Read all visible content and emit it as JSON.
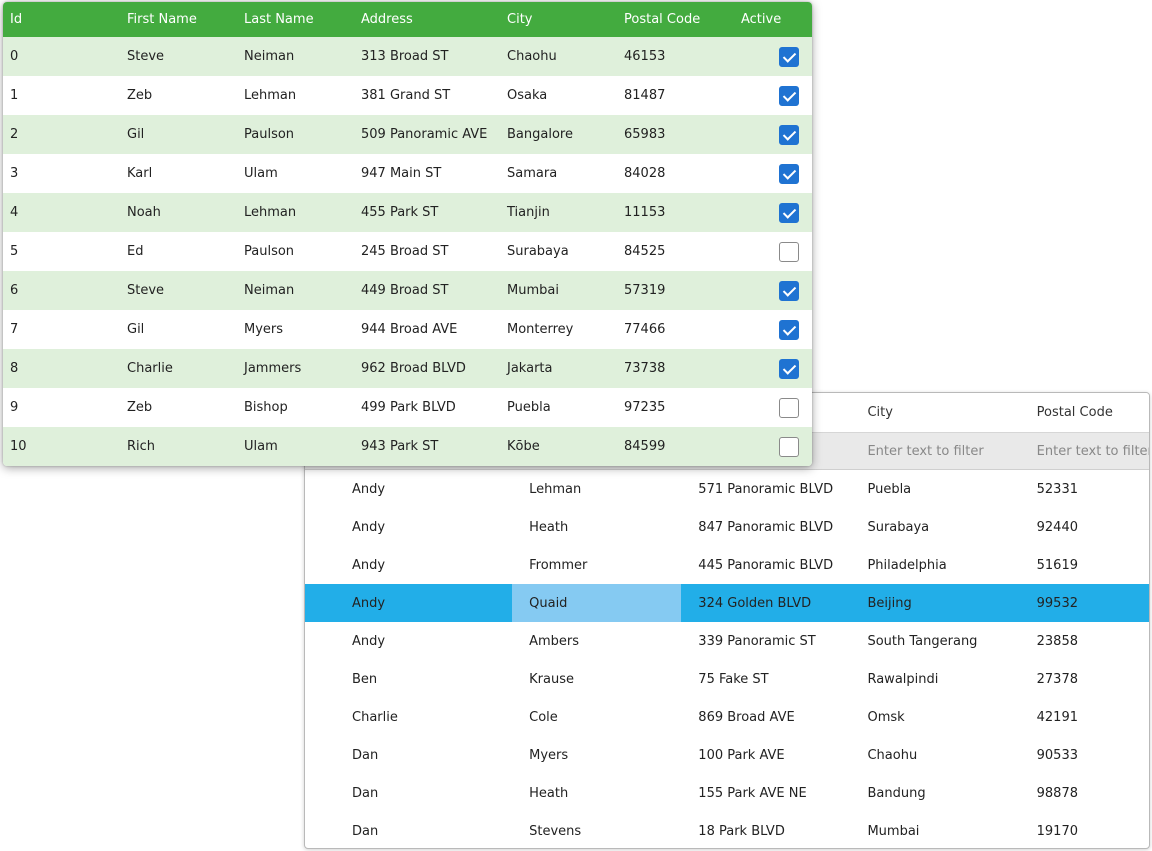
{
  "back_grid": {
    "header": [
      "",
      "",
      "",
      "City",
      "Postal Code"
    ],
    "filter_placeholders": [
      "",
      "",
      "",
      "Enter text to filter",
      "Enter text to filter"
    ],
    "rows": [
      [
        "Andy",
        "Lehman",
        "571 Panoramic BLVD",
        "Puebla",
        "52331"
      ],
      [
        "Andy",
        "Heath",
        "847 Panoramic BLVD",
        "Surabaya",
        "92440"
      ],
      [
        "Andy",
        "Frommer",
        "445 Panoramic BLVD",
        "Philadelphia",
        "51619"
      ],
      [
        "Andy",
        "Quaid",
        "324 Golden BLVD",
        "Beijing",
        "99532"
      ],
      [
        "Andy",
        "Ambers",
        "339 Panoramic ST",
        "South Tangerang",
        "23858"
      ],
      [
        "Ben",
        "Krause",
        "75 Fake ST",
        "Rawalpindi",
        "27378"
      ],
      [
        "Charlie",
        "Cole",
        "869 Broad AVE",
        "Omsk",
        "42191"
      ],
      [
        "Dan",
        "Myers",
        "100 Park AVE",
        "Chaohu",
        "90533"
      ],
      [
        "Dan",
        "Heath",
        "155 Park AVE NE",
        "Bandung",
        "98878"
      ],
      [
        "Dan",
        "Stevens",
        "18 Park BLVD",
        "Mumbai",
        "19170"
      ]
    ],
    "selected_row": 3,
    "focused_cell": 1
  },
  "front_grid": {
    "columns": [
      "Id",
      "First Name",
      "Last Name",
      "Address",
      "City",
      "Postal Code",
      "Active"
    ],
    "rows": [
      {
        "id": "0",
        "first": "Steve",
        "last": "Neiman",
        "address": "313 Broad ST",
        "city": "Chaohu",
        "postal": "46153",
        "active": true
      },
      {
        "id": "1",
        "first": "Zeb",
        "last": "Lehman",
        "address": "381 Grand ST",
        "city": "Ōsaka",
        "postal": "81487",
        "active": true
      },
      {
        "id": "2",
        "first": "Gil",
        "last": "Paulson",
        "address": "509 Panoramic AVE",
        "city": "Bangalore",
        "postal": "65983",
        "active": true
      },
      {
        "id": "3",
        "first": "Karl",
        "last": "Ulam",
        "address": "947 Main ST",
        "city": "Samara",
        "postal": "84028",
        "active": true
      },
      {
        "id": "4",
        "first": "Noah",
        "last": "Lehman",
        "address": "455 Park ST",
        "city": "Tianjin",
        "postal": "11153",
        "active": true
      },
      {
        "id": "5",
        "first": "Ed",
        "last": "Paulson",
        "address": "245 Broad ST",
        "city": "Surabaya",
        "postal": "84525",
        "active": false
      },
      {
        "id": "6",
        "first": "Steve",
        "last": "Neiman",
        "address": "449 Broad ST",
        "city": "Mumbai",
        "postal": "57319",
        "active": true
      },
      {
        "id": "7",
        "first": "Gil",
        "last": "Myers",
        "address": "944 Broad AVE",
        "city": "Monterrey",
        "postal": "77466",
        "active": true
      },
      {
        "id": "8",
        "first": "Charlie",
        "last": "Jammers",
        "address": "962 Broad BLVD",
        "city": "Jakarta",
        "postal": "73738",
        "active": true
      },
      {
        "id": "9",
        "first": "Zeb",
        "last": "Bishop",
        "address": "499 Park BLVD",
        "city": "Puebla",
        "postal": "97235",
        "active": false
      },
      {
        "id": "10",
        "first": "Rich",
        "last": "Ulam",
        "address": "943 Park ST",
        "city": "Kōbe",
        "postal": "84599",
        "active": false
      }
    ]
  },
  "colors": {
    "header_green": "#43ab3f",
    "alt_row_green": "#dff0db",
    "checkbox_blue": "#1f73d2",
    "selected_row_blue": "#22aee8",
    "focused_cell_blue": "#85caf2"
  }
}
